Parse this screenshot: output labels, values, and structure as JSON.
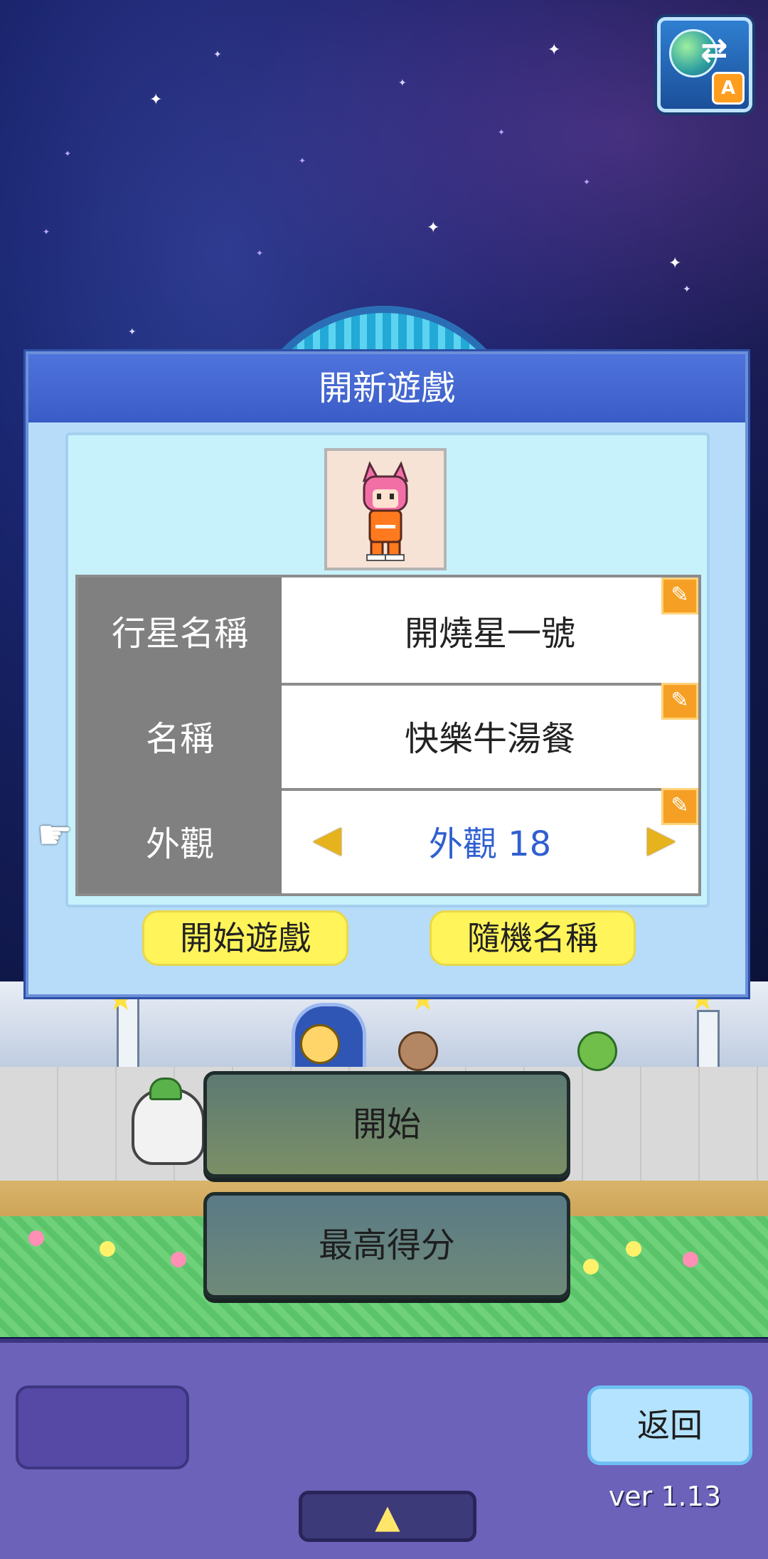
{
  "dialog": {
    "title": "開新遊戲",
    "fields": [
      {
        "label": "行星名稱",
        "value": "開燒星一號"
      },
      {
        "label": "名稱",
        "value": "快樂牛湯餐"
      },
      {
        "label": "外觀",
        "value": "外觀 18"
      }
    ],
    "start_game_label": "開始遊戲",
    "random_name_label": "隨機名稱",
    "prev_symbol": "◀",
    "next_symbol": "▶",
    "edit_symbol": "✎"
  },
  "menu": {
    "start_label": "開始",
    "highscore_label": "最高得分"
  },
  "bottom": {
    "back_label": "返回",
    "version": "ver 1.13",
    "up_symbol": "▲"
  },
  "top": {
    "world_badge": "A"
  },
  "icons": {
    "pointer": "pointing-hand-icon",
    "world": "globe-language-icon"
  },
  "colors": {
    "dialog_header": "#4f73dc",
    "panel_bg": "#c7f2fc",
    "label_bg": "#808080",
    "accent_blue": "#2f5fd0",
    "yellow_button": "#fff45a",
    "bottom_bar": "#6c62b9"
  }
}
